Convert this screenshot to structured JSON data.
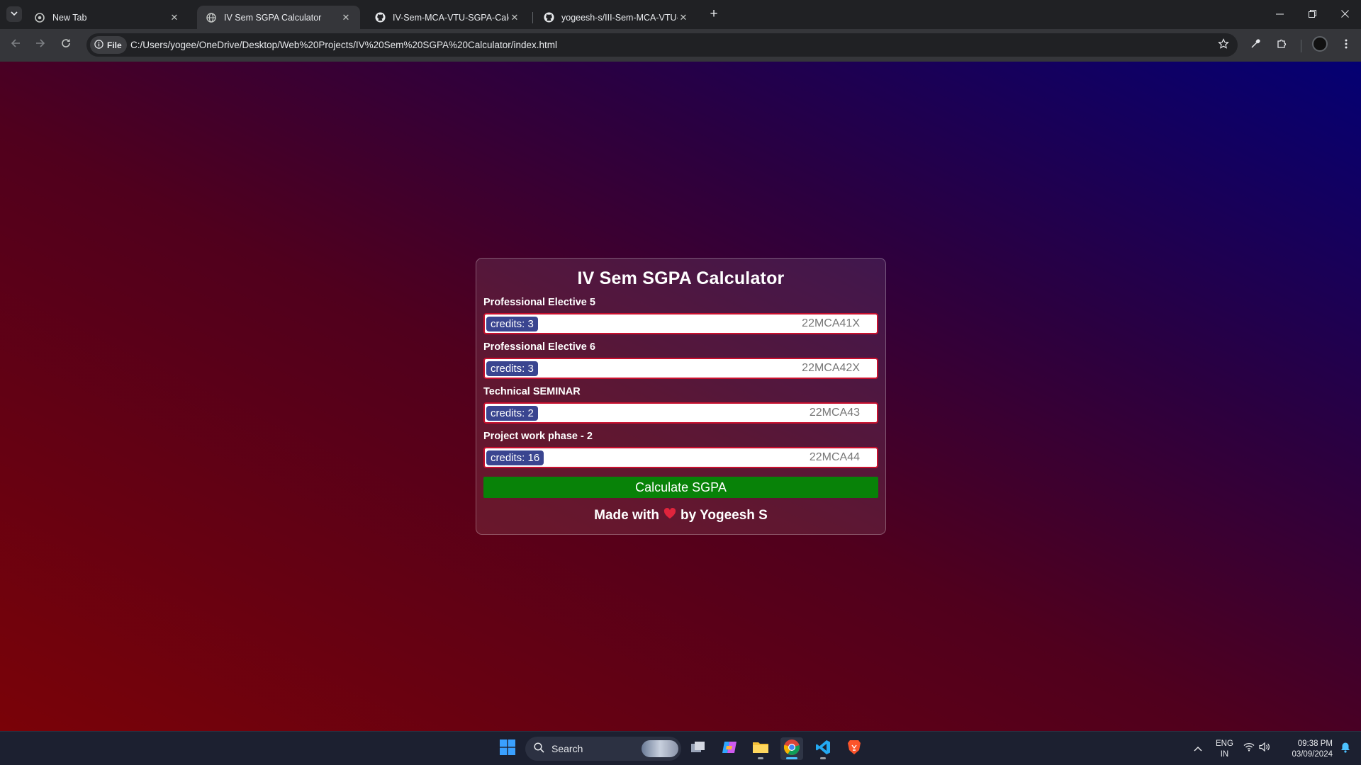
{
  "browser": {
    "tabs": [
      {
        "title": "New Tab",
        "icon": "chrome-icon",
        "active": false
      },
      {
        "title": "IV Sem SGPA Calculator",
        "icon": "globe-icon",
        "active": true
      },
      {
        "title": "IV-Sem-MCA-VTU-SGPA-Calcul",
        "icon": "github-icon",
        "active": false
      },
      {
        "title": "yogeesh-s/III-Sem-MCA-VTU-S",
        "icon": "github-icon",
        "active": false
      }
    ],
    "address": {
      "chip": "File",
      "url": "C:/Users/yogee/OneDrive/Desktop/Web%20Projects/IV%20Sem%20SGPA%20Calculator/index.html"
    }
  },
  "page": {
    "title": "IV Sem SGPA Calculator",
    "subjects": [
      {
        "label": "Professional Elective 5",
        "credits": "credits: 3",
        "code": "22MCA41X"
      },
      {
        "label": "Professional Elective 6",
        "credits": "credits: 3",
        "code": "22MCA42X"
      },
      {
        "label": "Technical SEMINAR",
        "credits": "credits: 2",
        "code": "22MCA43"
      },
      {
        "label": "Project work phase - 2",
        "credits": "credits: 16",
        "code": "22MCA44"
      }
    ],
    "calculate_button": "Calculate SGPA",
    "footer": {
      "before": "Made with",
      "after": "by Yogeesh S"
    },
    "colors": {
      "button": "#088208",
      "credits_badge": "#3a4590",
      "input_border": "#c8102e"
    }
  },
  "taskbar": {
    "search_label": "Search",
    "language": {
      "line1": "ENG",
      "line2": "IN"
    },
    "clock": {
      "time": "09:38 PM",
      "date": "03/09/2024"
    }
  }
}
